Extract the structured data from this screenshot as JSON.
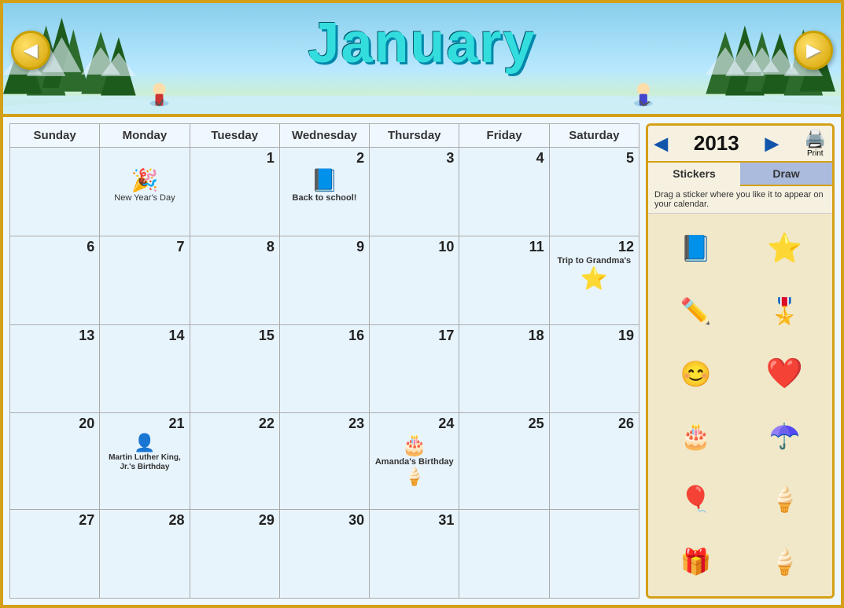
{
  "header": {
    "month": "January",
    "prev_label": "◀",
    "next_label": "▶"
  },
  "year_bar": {
    "year": "2013",
    "prev_year": "◀",
    "next_year": "▶",
    "print_label": "Print"
  },
  "calendar": {
    "days_of_week": [
      "Sunday",
      "Monday",
      "Tuesday",
      "Wednesday",
      "Thursday",
      "Friday",
      "Saturday"
    ],
    "weeks": [
      [
        {
          "day": "",
          "note": "",
          "sticker": ""
        },
        {
          "day": "",
          "note": "New Year's Day",
          "sticker": "🎉"
        },
        {
          "day": "1",
          "note": "",
          "sticker": ""
        },
        {
          "day": "2",
          "note": "Back to school!",
          "sticker": "📘"
        },
        {
          "day": "3",
          "note": "",
          "sticker": ""
        },
        {
          "day": "4",
          "note": "",
          "sticker": ""
        },
        {
          "day": "5",
          "note": "",
          "sticker": ""
        }
      ],
      [
        {
          "day": "6",
          "note": "",
          "sticker": ""
        },
        {
          "day": "7",
          "note": "",
          "sticker": ""
        },
        {
          "day": "8",
          "note": "",
          "sticker": ""
        },
        {
          "day": "9",
          "note": "",
          "sticker": ""
        },
        {
          "day": "10",
          "note": "",
          "sticker": ""
        },
        {
          "day": "11",
          "note": "",
          "sticker": ""
        },
        {
          "day": "12",
          "note": "Trip to Grandma's",
          "sticker": "⭐"
        }
      ],
      [
        {
          "day": "13",
          "note": "",
          "sticker": ""
        },
        {
          "day": "14",
          "note": "",
          "sticker": ""
        },
        {
          "day": "15",
          "note": "",
          "sticker": ""
        },
        {
          "day": "16",
          "note": "",
          "sticker": ""
        },
        {
          "day": "17",
          "note": "",
          "sticker": ""
        },
        {
          "day": "18",
          "note": "",
          "sticker": ""
        },
        {
          "day": "19",
          "note": "",
          "sticker": ""
        }
      ],
      [
        {
          "day": "20",
          "note": "",
          "sticker": ""
        },
        {
          "day": "21",
          "note": "Martin Luther King, Jr.'s Birthday",
          "sticker": "👤"
        },
        {
          "day": "22",
          "note": "",
          "sticker": ""
        },
        {
          "day": "23",
          "note": "",
          "sticker": ""
        },
        {
          "day": "24",
          "note": "Amanda's Birthday",
          "sticker": "🎂"
        },
        {
          "day": "25",
          "note": "",
          "sticker": ""
        },
        {
          "day": "26",
          "note": "",
          "sticker": ""
        }
      ],
      [
        {
          "day": "27",
          "note": "",
          "sticker": ""
        },
        {
          "day": "28",
          "note": "",
          "sticker": ""
        },
        {
          "day": "29",
          "note": "",
          "sticker": ""
        },
        {
          "day": "30",
          "note": "",
          "sticker": ""
        },
        {
          "day": "31",
          "note": "",
          "sticker": ""
        },
        {
          "day": "",
          "note": "",
          "sticker": ""
        },
        {
          "day": "",
          "note": "",
          "sticker": ""
        }
      ]
    ]
  },
  "sidebar": {
    "stickers_tab": "Stickers",
    "draw_tab": "Draw",
    "desc": "Drag a sticker where you like it to appear on your calendar.",
    "stickers": [
      {
        "name": "book",
        "emoji": "📘"
      },
      {
        "name": "star",
        "emoji": "⭐"
      },
      {
        "name": "pencil",
        "emoji": "✏️"
      },
      {
        "name": "ribbon",
        "emoji": "🎖️"
      },
      {
        "name": "smiley",
        "emoji": "😊"
      },
      {
        "name": "heart",
        "emoji": "❤️"
      },
      {
        "name": "cake",
        "emoji": "🎂"
      },
      {
        "name": "umbrella",
        "emoji": "☂️"
      },
      {
        "name": "balloons",
        "emoji": "🎈"
      },
      {
        "name": "ice-cream",
        "emoji": "🍦"
      },
      {
        "name": "gift",
        "emoji": "🎁"
      },
      {
        "name": "ice-cream2",
        "emoji": "🍦"
      }
    ]
  }
}
